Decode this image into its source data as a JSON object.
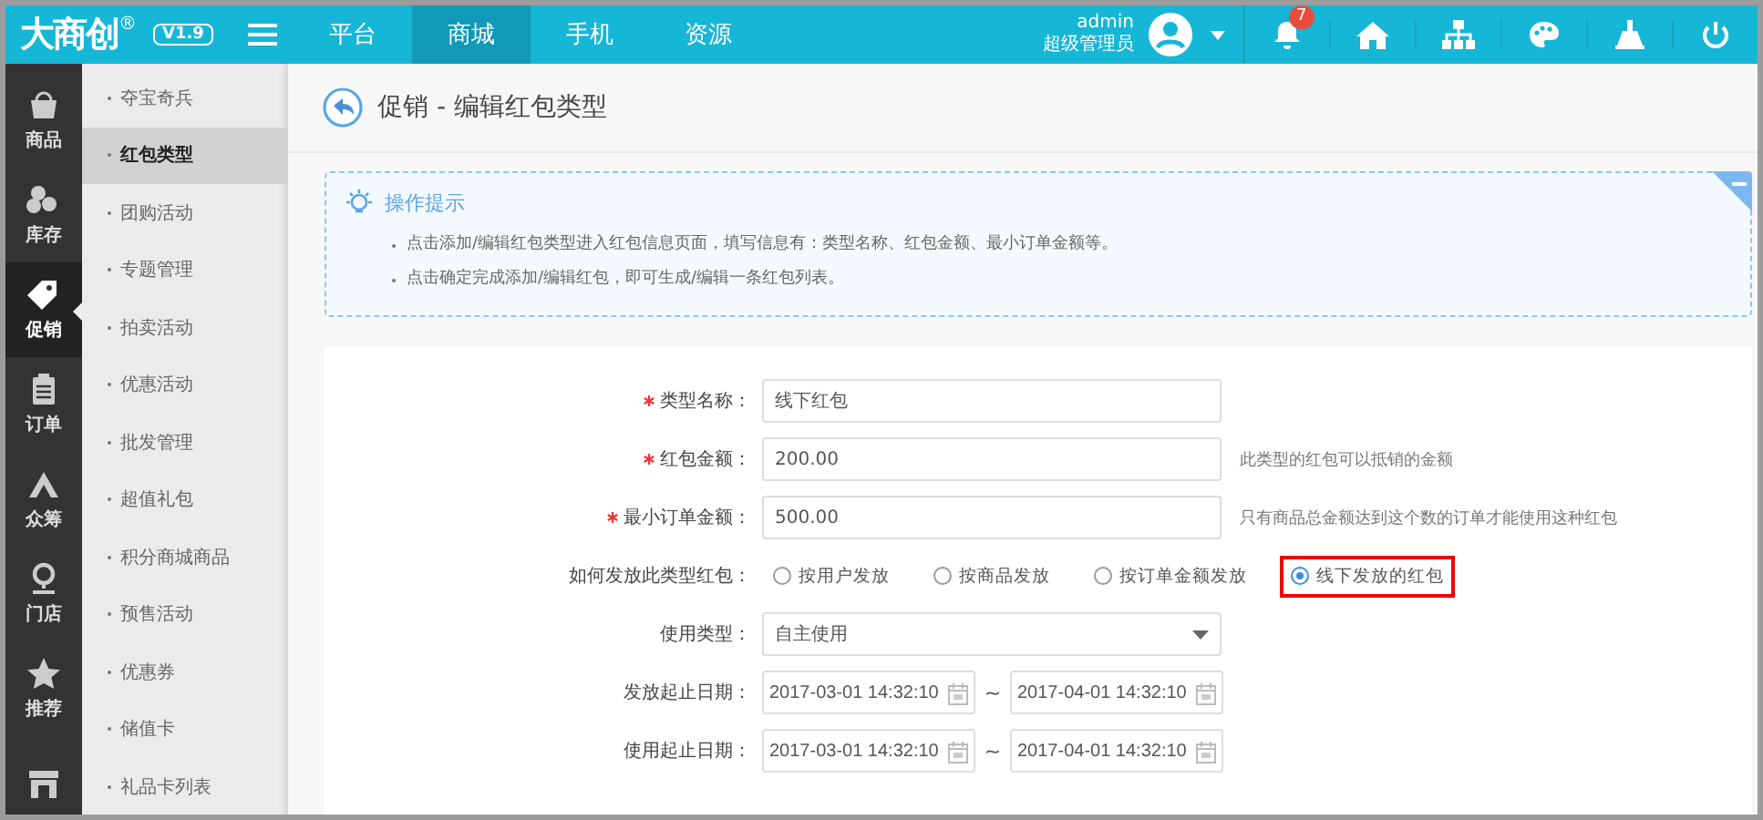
{
  "brand": {
    "logo": "大商创",
    "mark": "®",
    "version": "V1.9"
  },
  "top_nav": [
    {
      "label": "平台",
      "selected": false
    },
    {
      "label": "商城",
      "selected": true
    },
    {
      "label": "手机",
      "selected": false
    },
    {
      "label": "资源",
      "selected": false
    }
  ],
  "user": {
    "name": "admin",
    "role": "超级管理员"
  },
  "notifications": {
    "count": "7"
  },
  "sidebar": {
    "items": [
      {
        "label": "商品",
        "selected": false
      },
      {
        "label": "库存",
        "selected": false
      },
      {
        "label": "促销",
        "selected": true
      },
      {
        "label": "订单",
        "selected": false
      },
      {
        "label": "众筹",
        "selected": false
      },
      {
        "label": "门店",
        "selected": false
      },
      {
        "label": "推荐",
        "selected": false
      },
      {
        "selected": false
      }
    ]
  },
  "submenu": {
    "items": [
      {
        "label": "夺宝奇兵",
        "selected": false
      },
      {
        "label": "红包类型",
        "selected": true
      },
      {
        "label": "团购活动",
        "selected": false
      },
      {
        "label": "专题管理",
        "selected": false
      },
      {
        "label": "拍卖活动",
        "selected": false
      },
      {
        "label": "优惠活动",
        "selected": false
      },
      {
        "label": "批发管理",
        "selected": false
      },
      {
        "label": "超值礼包",
        "selected": false
      },
      {
        "label": "积分商城商品",
        "selected": false
      },
      {
        "label": "预售活动",
        "selected": false
      },
      {
        "label": "优惠券",
        "selected": false
      },
      {
        "label": "储值卡",
        "selected": false
      },
      {
        "label": "礼品卡列表",
        "selected": false
      }
    ]
  },
  "page_title": "促销 - 编辑红包类型",
  "tips": {
    "title": "操作提示",
    "items": [
      "点击添加/编辑红包类型进入红包信息页面，填写信息有：类型名称、红包金额、最小订单金额等。",
      "点击确定完成添加/编辑红包，即可生成/编辑一条红包列表。"
    ]
  },
  "form": {
    "fields": [
      {
        "kind": "text",
        "required": true,
        "label": "类型名称：",
        "value": "线下红包"
      },
      {
        "kind": "text",
        "required": true,
        "label": "红包金额：",
        "value": "200.00",
        "hint": "此类型的红包可以抵销的金额"
      },
      {
        "kind": "text",
        "required": true,
        "label": "最小订单金额：",
        "value": "500.00",
        "hint": "只有商品总金额达到这个数的订单才能使用这种红包"
      },
      {
        "kind": "radio",
        "required": false,
        "label": "如何发放此类型红包：",
        "options": [
          {
            "label": "按用户发放",
            "selected": false,
            "highlighted": false
          },
          {
            "label": "按商品发放",
            "selected": false,
            "highlighted": false
          },
          {
            "label": "按订单金额发放",
            "selected": false,
            "highlighted": false
          },
          {
            "label": "线下发放的红包",
            "selected": true,
            "highlighted": true
          }
        ]
      },
      {
        "kind": "select",
        "required": false,
        "label": "使用类型：",
        "value": "自主使用"
      },
      {
        "kind": "daterange",
        "required": false,
        "label": "发放起止日期：",
        "start": "2017-03-01 14:32:10",
        "separator": "~",
        "end": "2017-04-01 14:32:10"
      },
      {
        "kind": "daterange",
        "required": false,
        "label": "使用起止日期：",
        "start": "2017-03-01 14:32:10",
        "separator": "~",
        "end": "2017-04-01 14:32:10"
      }
    ]
  }
}
